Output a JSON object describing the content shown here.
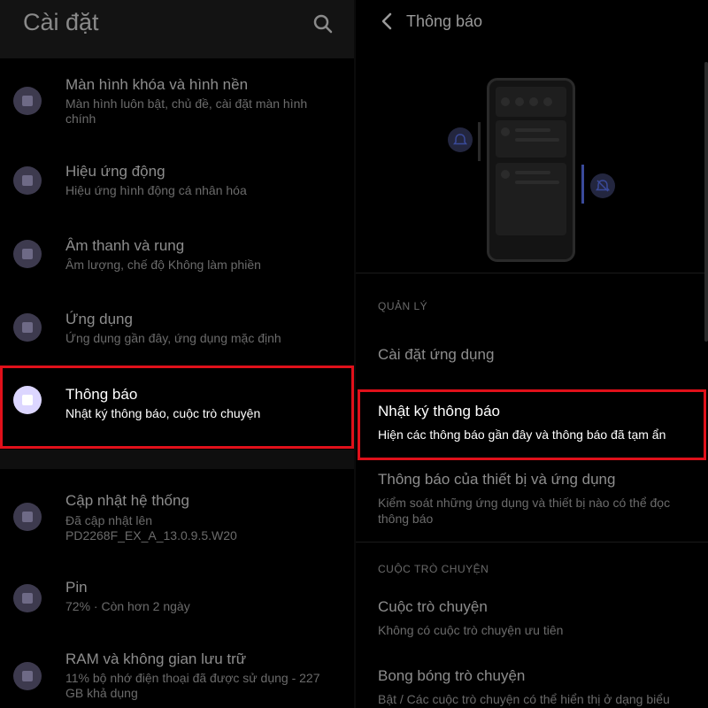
{
  "left": {
    "title": "Cài đặt",
    "items": [
      {
        "title": "Màn hình khóa và hình nền",
        "subtitle": "Màn hình luôn bật, chủ đề, cài đặt màn hình chính"
      },
      {
        "title": "Hiệu ứng động",
        "subtitle": "Hiệu ứng hình động cá nhân hóa"
      },
      {
        "title": "Âm thanh và rung",
        "subtitle": "Âm lượng, chế độ Không làm phiền"
      },
      {
        "title": "Ứng dụng",
        "subtitle": "Ứng dụng gần đây, ứng dụng mặc định"
      },
      {
        "title": "Thông báo",
        "subtitle": "Nhật ký thông báo, cuộc trò chuyện"
      },
      {
        "title": "Cập nhật hệ thống",
        "subtitle": "Đã cập nhật lên PD2268F_EX_A_13.0.9.5.W20"
      },
      {
        "title": "Pin",
        "subtitle": "72% · Còn hơn 2 ngày"
      },
      {
        "title": "RAM và không gian lưu trữ",
        "subtitle": "11% bộ nhớ điện thoại đã được sử dụng - 227 GB khả dụng"
      }
    ]
  },
  "right": {
    "title": "Thông báo",
    "section_manage": "QUẢN LÝ",
    "app_settings": "Cài đặt ứng dụng",
    "notif_log": {
      "title": "Nhật ký thông báo",
      "subtitle": "Hiện các thông báo gần đây và thông báo đã tạm ẩn"
    },
    "device_notif": {
      "title": "Thông báo của thiết bị và ứng dụng",
      "subtitle": "Kiểm soát những ứng dụng và thiết bị nào có thể đọc thông báo"
    },
    "section_convo": "CUỘC TRÒ CHUYỆN",
    "conversations": {
      "title": "Cuộc trò chuyện",
      "subtitle": "Không có cuộc trò chuyện ưu tiên"
    },
    "bubbles": {
      "title": "Bong bóng trò chuyện",
      "subtitle": "Bật / Các cuộc trò chuyện có thể hiển thị ở dạng biểu"
    }
  },
  "colors": {
    "highlight": "#e0101a",
    "accent_icon": "#dcd6ff"
  }
}
